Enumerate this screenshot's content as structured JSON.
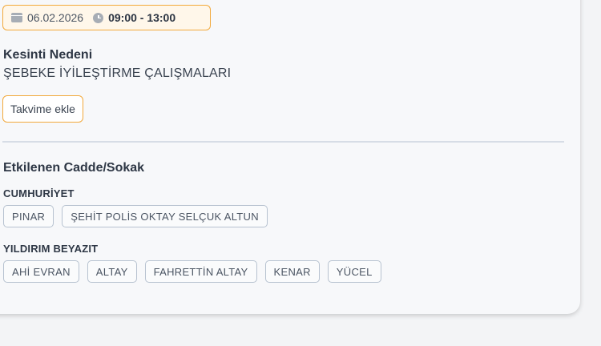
{
  "outage": {
    "date": "06.02.2026",
    "time": "09:00 - 13:00",
    "reason_label": "Kesinti Nedeni",
    "reason_text": "ŞEBEKE İYİLEŞTİRME ÇALIŞMALARI",
    "add_calendar_label": "Takvime ekle"
  },
  "streets": {
    "title": "Etkilenen Cadde/Sokak",
    "groups": [
      {
        "name": "CUMHURİYET",
        "items": [
          "PINAR",
          "ŞEHİT POLİS OKTAY SELÇUK ALTUN"
        ]
      },
      {
        "name": "YILDIRIM BEYAZIT",
        "items": [
          "AHİ EVRAN",
          "ALTAY",
          "FAHRETTİN ALTAY",
          "KENAR",
          "YÜCEL"
        ]
      }
    ]
  },
  "icons": {
    "date": "calendar-icon",
    "time": "clock-icon"
  }
}
